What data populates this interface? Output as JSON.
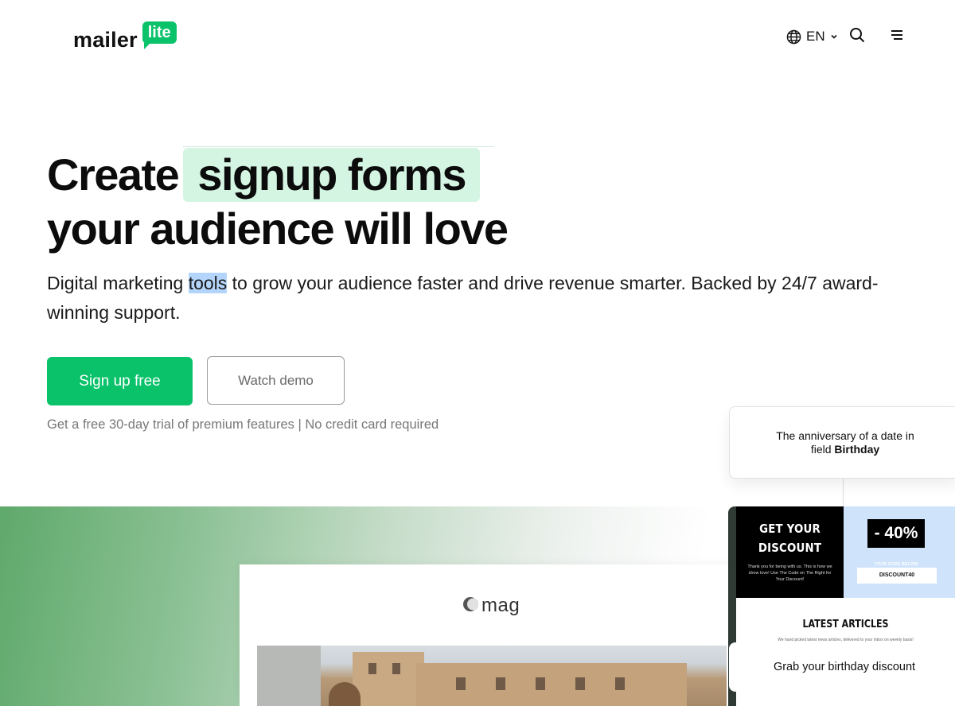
{
  "header": {
    "logo_text": "mailer",
    "logo_badge": "lite",
    "language": "EN",
    "icons": {
      "language": "globe-icon",
      "language_caret": "chevron-down-icon",
      "search": "search-icon",
      "menu": "menu-icon"
    }
  },
  "hero": {
    "headline_prefix": "Create",
    "headline_highlight": "signup forms",
    "headline_line2": "your audience will love",
    "subtext_before": "Digital marketing ",
    "subtext_selected": "tools",
    "subtext_after": " to grow your audience faster and drive revenue smarter. Backed by 24/7 award-winning support.",
    "cta_primary": "Sign up free",
    "cta_secondary": "Watch demo",
    "trial_note": "Get a free 30-day trial of premium features | No credit card required"
  },
  "showcase": {
    "mag_logo": "mag",
    "anniversary_prefix": "The anniversary of a date in field ",
    "anniversary_field": "Birthday",
    "email": {
      "discount_title_line1": "GET YOUR",
      "discount_title_line2": "DISCOUNT",
      "discount_small": "Thank you for being with us. This is how we show love! Use The Code on The Right for Your Discount!",
      "percent": "- 40%",
      "code_label": "YOUR CODE BELOW",
      "code": "DISCOUNT40",
      "articles_title": "LATEST ARTICLES",
      "articles_small": "We hand picked latest news articles, delivered to your inbox on weekly basis!"
    },
    "birthday_card": "Grab your birthday discount"
  },
  "colors": {
    "brand_green": "#09c269",
    "highlight_mint": "#d5f5e3",
    "selection_blue": "#b4d5fb",
    "discount_blue": "#cfe3fb"
  }
}
